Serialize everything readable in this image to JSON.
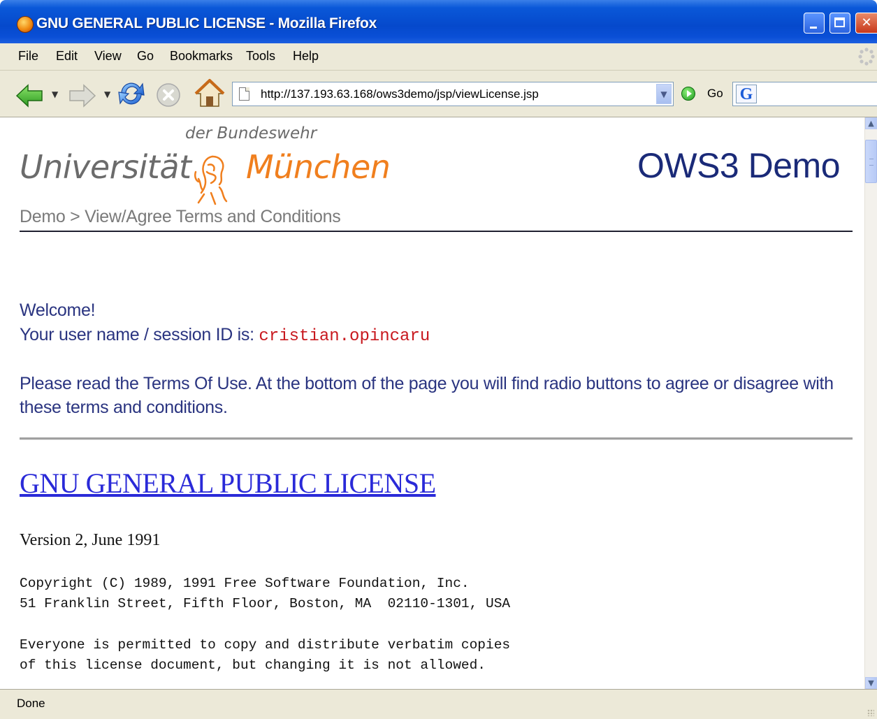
{
  "window": {
    "title": "GNU GENERAL PUBLIC LICENSE - Mozilla Firefox"
  },
  "menu": {
    "items": [
      "File",
      "Edit",
      "View",
      "Go",
      "Bookmarks",
      "Tools",
      "Help"
    ]
  },
  "toolbar": {
    "url": "http://137.193.63.168/ows3demo/jsp/viewLicense.jsp",
    "go_label": "Go",
    "icons": [
      "back-arrow-icon",
      "forward-arrow-icon",
      "reload-icon",
      "stop-icon",
      "home-icon",
      "page-icon",
      "dropdown-icon",
      "go-icon",
      "google-search-icon"
    ]
  },
  "page": {
    "logo": {
      "top": "der Bundeswehr",
      "left": "Universität",
      "right": "München"
    },
    "app_title": "OWS3 Demo",
    "breadcrumb": "Demo > View/Agree Terms and Conditions",
    "welcome": "Welcome!",
    "session_label": "Your user name / session ID is: ",
    "session_id": "cristian.opincaru",
    "instructions": "Please read the Terms Of Use. At the bottom of the page you will find radio buttons to agree or disagree with these terms and conditions.",
    "license_title": "GNU GENERAL PUBLIC LICENSE",
    "version": "Version 2, June 1991",
    "copyright": "Copyright (C) 1989, 1991 Free Software Foundation, Inc.\n51 Franklin Street, Fifth Floor, Boston, MA  02110-1301, USA",
    "permission": "Everyone is permitted to copy and distribute verbatim copies\nof this license document, but changing it is not allowed."
  },
  "status": {
    "text": "Done"
  },
  "colors": {
    "titlebar": "#0549cc",
    "logo_orange": "#f07f1e",
    "logo_gray": "#6b6b6b",
    "heading_navy": "#1a2a78",
    "body_text": "#2a3480",
    "session_red": "#c8181e",
    "link_blue": "#2a2ad8"
  }
}
